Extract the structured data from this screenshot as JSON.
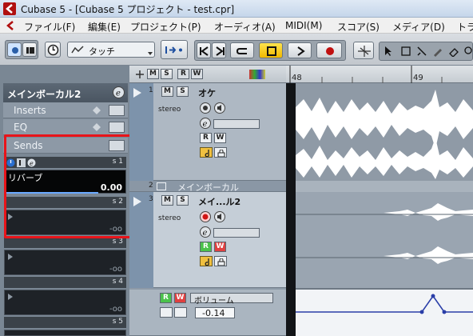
{
  "window": {
    "title": "Cubase 5 - [Cubase 5 プロジェクト - test.cpr]"
  },
  "menu": [
    "ファイル(F)",
    "編集(E)",
    "プロジェクト(P)",
    "オーディオ(A)",
    "MIDI(M)",
    "スコア(S)",
    "メディア(D)",
    "トラ"
  ],
  "toolbar": {
    "automation_mode": "タッチ"
  },
  "ruler": {
    "bar1": "48",
    "bar2": "49"
  },
  "inspector": {
    "track_name": "メインボーカル2",
    "sections": [
      "Inserts",
      "EQ",
      "Sends"
    ],
    "send1": {
      "slot": "s 1",
      "name": "リバーブ",
      "value": "0.00"
    },
    "send2": {
      "slot": "s 2",
      "value": "-oo"
    },
    "send3": {
      "slot": "s 3",
      "value": "-oo"
    },
    "send4": {
      "slot": "s 4",
      "value": "-oo"
    },
    "send5": {
      "slot": "s 5"
    }
  },
  "tracks": [
    {
      "num": "1",
      "name": "オケ",
      "format": "stereo"
    },
    {
      "num": "2",
      "name": "メインボーカル"
    },
    {
      "num": "3",
      "name": "メイ...ル2",
      "format": "stereo"
    }
  ],
  "automation": {
    "param": "ボリューム",
    "value": "-0.14"
  },
  "buttons": {
    "mute": "M",
    "solo": "S",
    "read": "R",
    "write": "W"
  },
  "colors": {
    "highlight_box": "#e8141a",
    "waveform": "#ffffff",
    "event_bg": "#8f9aa6"
  }
}
